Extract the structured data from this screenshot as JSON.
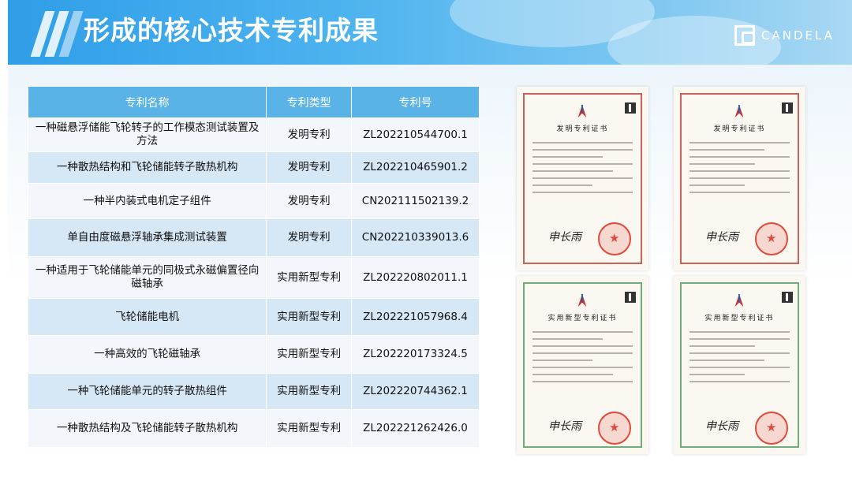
{
  "header": {
    "title": "形成的核心技术专利成果",
    "logo_text": "CANDELA"
  },
  "table": {
    "headers": [
      "专利名称",
      "专利类型",
      "专利号"
    ],
    "rows": [
      {
        "name": "一种磁悬浮储能飞轮转子的工作模态测试装置及方法",
        "type": "发明专利",
        "number": "ZL202210544700.1"
      },
      {
        "name": "一种散热结构和飞轮储能转子散热机构",
        "type": "发明专利",
        "number": "ZL202210465901.2"
      },
      {
        "name": "一种半内装式电机定子组件",
        "type": "发明专利",
        "number": "CN202111502139.2"
      },
      {
        "name": "单自由度磁悬浮轴承集成测试装置",
        "type": "发明专利",
        "number": "CN202210339013.6"
      },
      {
        "name": "一种适用于飞轮储能单元的同极式永磁偏置径向磁轴承",
        "type": "实用新型专利",
        "number": "ZL202220802011.1"
      },
      {
        "name": "飞轮储能电机",
        "type": "实用新型专利",
        "number": "ZL202221057968.4"
      },
      {
        "name": "一种高效的飞轮磁轴承",
        "type": "实用新型专利",
        "number": "ZL202220173324.5"
      },
      {
        "name": "一种飞轮储能单元的转子散热组件",
        "type": "实用新型专利",
        "number": "ZL202220744362.1"
      },
      {
        "name": "一种散热结构及飞轮储能转子散热机构",
        "type": "实用新型专利",
        "number": "ZL202221262426.0"
      }
    ]
  },
  "certificates": [
    {
      "title": "发明专利证书",
      "signature": "申长雨",
      "color": "#c9625a"
    },
    {
      "title": "发明专利证书",
      "signature": "申长雨",
      "color": "#c9625a"
    },
    {
      "title": "实用新型专利证书",
      "signature": "申长雨",
      "color": "#6fae7a"
    },
    {
      "title": "实用新型专利证书",
      "signature": "申长雨",
      "color": "#6fae7a"
    }
  ],
  "colors": {
    "header_blue": "#2f9ee8",
    "table_header": "#5ab3e6",
    "row_light": "#f3f7fb",
    "row_dark": "#d6e7f5"
  }
}
